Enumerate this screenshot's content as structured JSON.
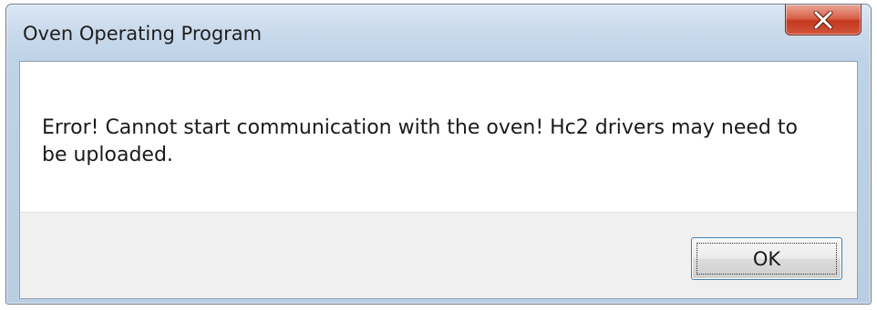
{
  "window": {
    "title": "Oven Operating Program"
  },
  "titlebar": {
    "close_icon": "close-x-icon",
    "close_color": "#c7422a"
  },
  "dialog": {
    "message": "Error!  Cannot start communication with the oven!  Hc2 drivers may need to be uploaded.",
    "ok_label": "OK"
  }
}
